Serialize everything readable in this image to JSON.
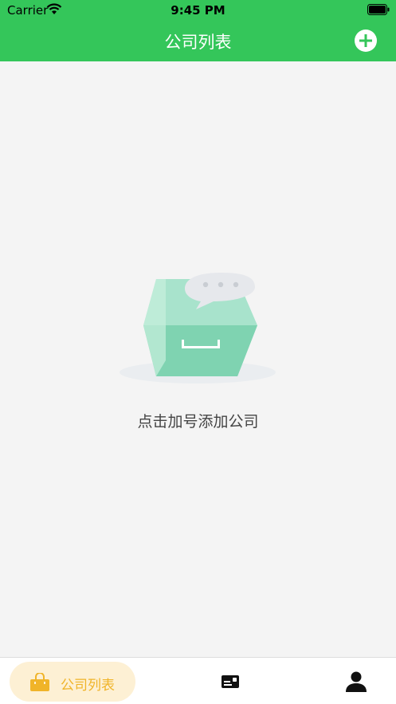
{
  "status_bar": {
    "carrier": "Carrier",
    "time": "9:45 PM",
    "icons": [
      "wifi-icon",
      "battery-icon"
    ]
  },
  "header": {
    "title": "公司列表",
    "add_icon": "plus-circle-icon",
    "background_color": "#34c65a"
  },
  "empty_state": {
    "illustration": "empty-box-illustration",
    "message": "点击加号添加公司"
  },
  "tab_bar": {
    "tabs": [
      {
        "label": "公司列表",
        "icon": "shopping-bag-icon",
        "active": true
      },
      {
        "label": "",
        "icon": "id-card-icon",
        "active": false
      },
      {
        "label": "",
        "icon": "person-icon",
        "active": false
      }
    ],
    "active_color": "#f0b429",
    "active_bg": "#fdf0d4"
  }
}
